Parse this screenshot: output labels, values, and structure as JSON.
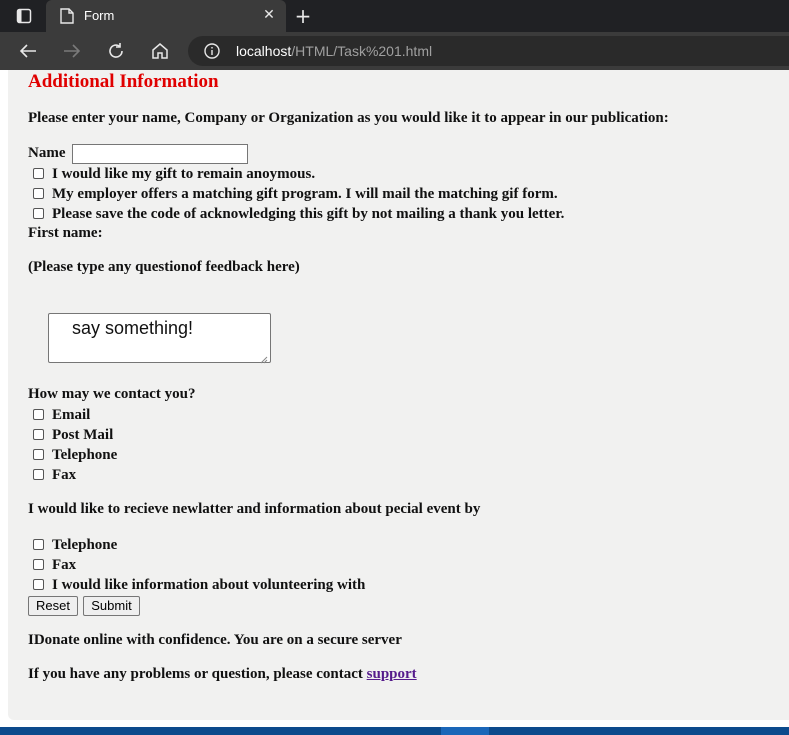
{
  "browser": {
    "tab_title": "Form",
    "url_host": "localhost",
    "url_path": "/HTML/Task%201.html"
  },
  "form": {
    "heading": "Additional Information",
    "intro": "Please enter your name, Company or Organization as you would like it to appear in our publication:",
    "name_label": "Name",
    "name_value": "",
    "options": [
      {
        "label": "I would like my gift to remain anoymous.",
        "checked": false
      },
      {
        "label": "My employer offers a matching gift program. I will mail the matching gif form.",
        "checked": false
      },
      {
        "label": "Please save the code of acknowledging this gift by not mailing a thank you letter.",
        "checked": false
      }
    ],
    "first_name_label": "First name:",
    "feedback_prompt": "(Please type any questionof feedback here)",
    "feedback_value": "say something!",
    "contact_question": "How may we contact you?",
    "contact_options": [
      {
        "label": "Email",
        "checked": false
      },
      {
        "label": "Post Mail",
        "checked": false
      },
      {
        "label": "Telephone",
        "checked": false
      },
      {
        "label": "Fax",
        "checked": false
      }
    ],
    "newsletter_question": "I would like to recieve newlatter and information about pecial event by",
    "newsletter_options": [
      {
        "label": "Telephone",
        "checked": false
      },
      {
        "label": "Fax",
        "checked": false
      },
      {
        "label": "I would like information about volunteering with",
        "checked": false
      }
    ],
    "reset_label": "Reset",
    "submit_label": "Submit",
    "secure_note": "IDonate online with confidence. You are on a secure server",
    "contact_note": "If you have any problems or question, please contact",
    "support_link": "support"
  },
  "colors": {
    "heading": "#e00000",
    "link": "#551a8b",
    "panel_bg": "#f1f1f0",
    "chrome_dark": "#202124",
    "chrome_mid": "#3b3b3b"
  },
  "icons": {
    "tab_actions": "tab-actions-icon",
    "favicon": "page-icon",
    "close": "close-icon",
    "new_tab": "plus-icon",
    "back": "back-arrow-icon",
    "forward": "forward-arrow-icon",
    "refresh": "refresh-icon",
    "home": "home-icon",
    "site_info": "info-icon"
  }
}
